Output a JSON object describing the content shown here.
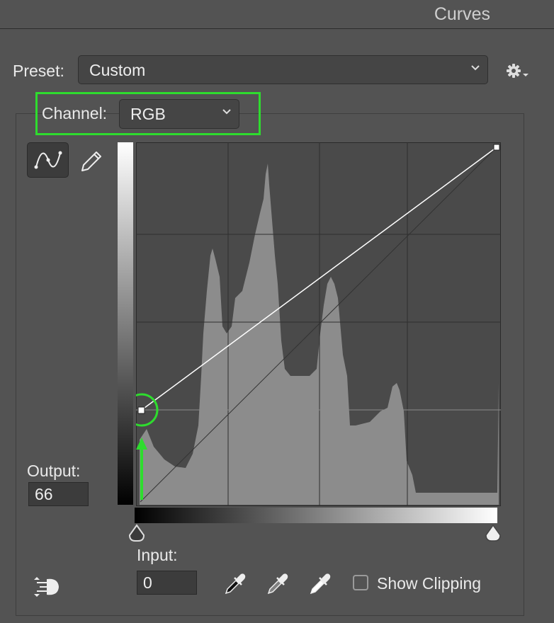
{
  "window": {
    "title": "Curves"
  },
  "preset": {
    "label": "Preset:",
    "value": "Custom"
  },
  "channel": {
    "label": "Channel:",
    "value": "RGB"
  },
  "output": {
    "label": "Output:",
    "value": "66"
  },
  "input": {
    "label": "Input:",
    "value": "0"
  },
  "show_clipping": {
    "label": "Show Clipping",
    "checked": false
  },
  "curve": {
    "points": [
      {
        "input": 0,
        "output": 66
      },
      {
        "input": 255,
        "output": 255
      }
    ],
    "selected_point": {
      "input": 0,
      "output": 66
    }
  },
  "colors": {
    "highlight": "#2edc2e",
    "background": "#535353",
    "graph_bg": "#4a4a4a",
    "histogram": "#8c8c8c"
  },
  "icons": [
    "gear-icon",
    "curve-tool-icon",
    "pencil-icon",
    "eyedropper-black-icon",
    "eyedropper-gray-icon",
    "eyedropper-white-icon",
    "auto-icon"
  ]
}
